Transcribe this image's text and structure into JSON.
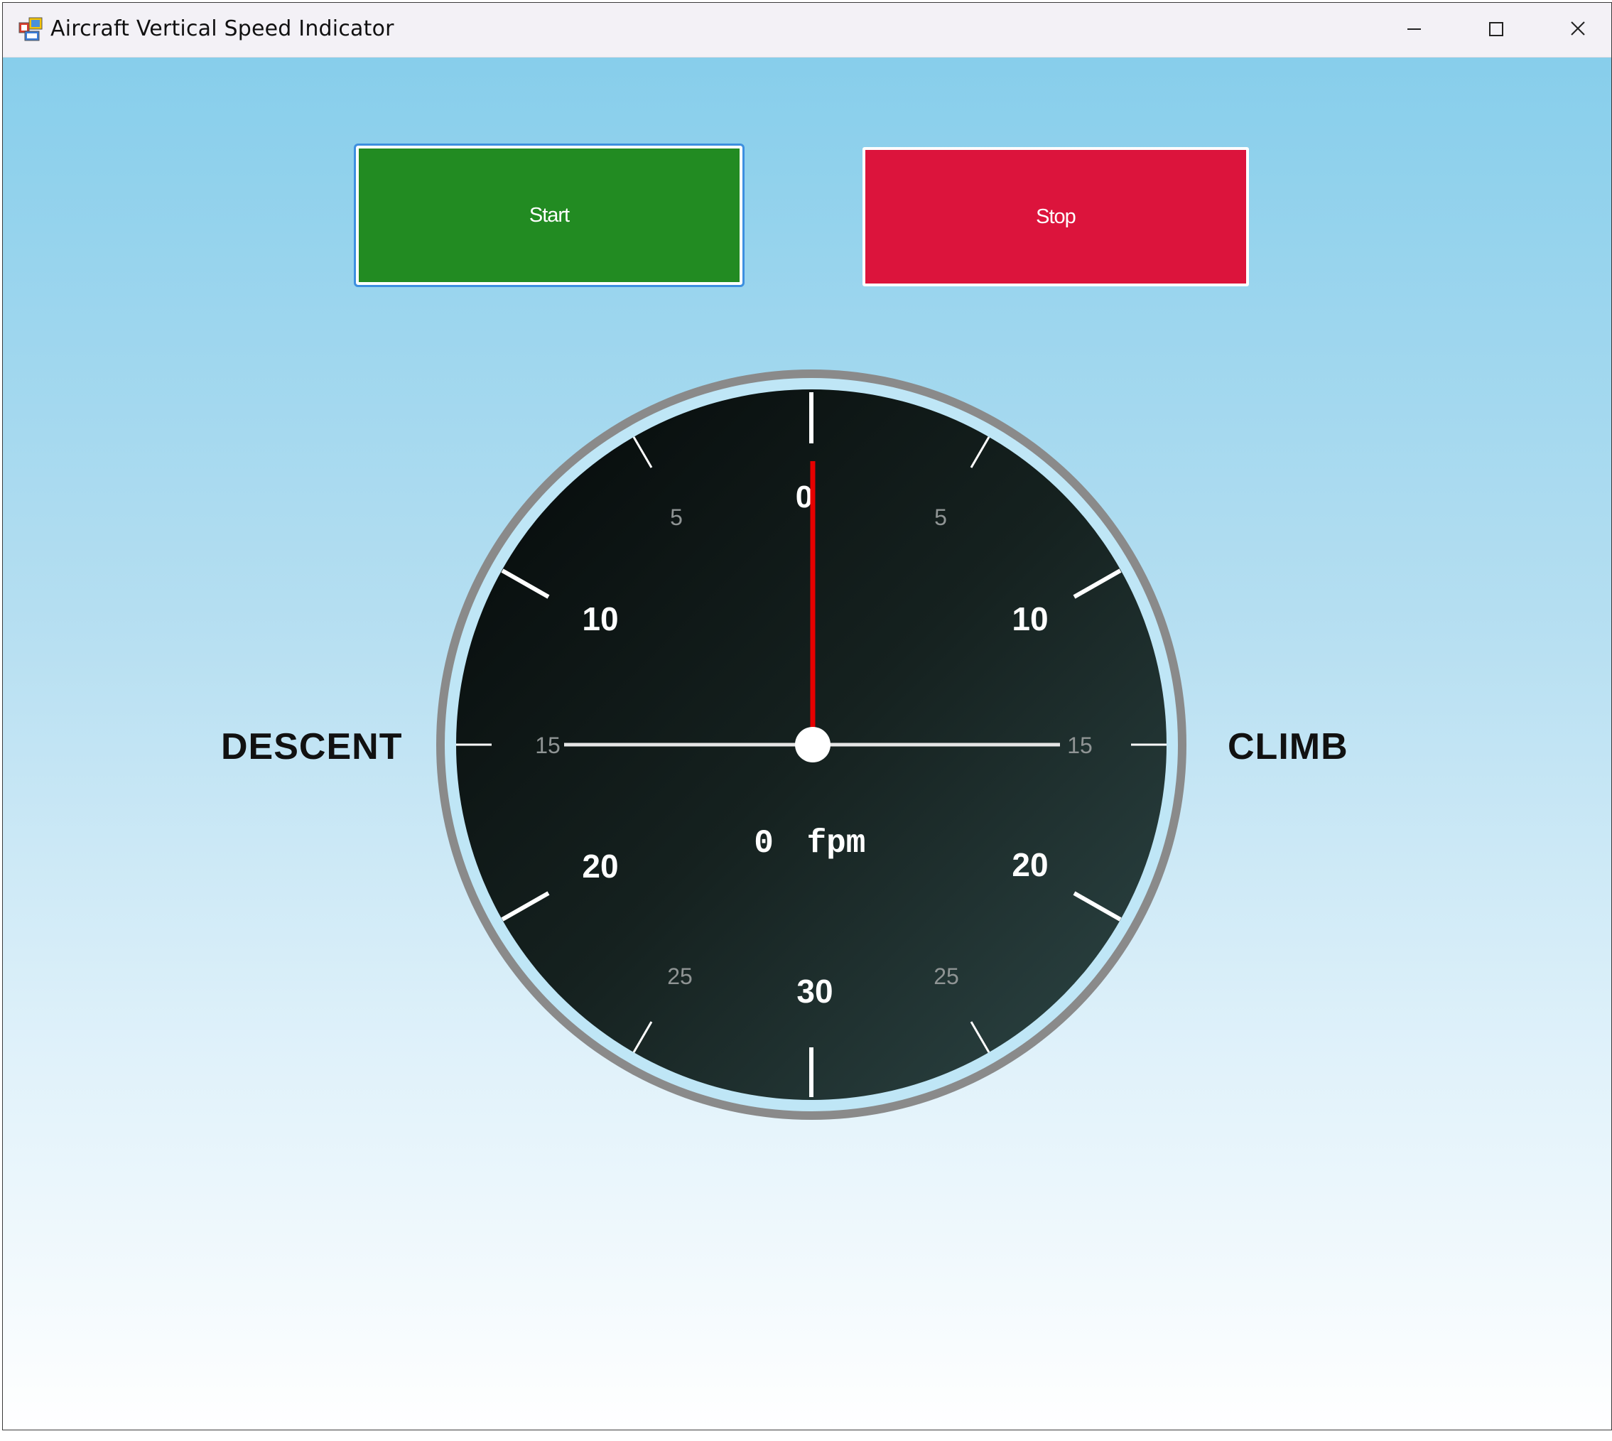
{
  "window": {
    "title": "Aircraft Vertical Speed Indicator"
  },
  "titlebar": {
    "app_icon": "app-windows-icon",
    "controls": [
      "minimize-icon",
      "maximize-icon",
      "close-icon"
    ]
  },
  "controls": {
    "start_label": "Start",
    "stop_label": "Stop"
  },
  "labels": {
    "descent": "DESCENT",
    "climb": "CLIMB"
  },
  "gauge": {
    "major_labels": {
      "top": "0",
      "left_upper": "10",
      "right_upper": "10",
      "left_lower": "20",
      "right_lower": "20",
      "bottom": "30"
    },
    "minor_labels": {
      "left_top": "5",
      "right_top": "5",
      "left_mid": "15",
      "right_mid": "15",
      "left_bottom": "25",
      "right_bottom": "25"
    },
    "readout_value": "0",
    "readout_unit": "fpm",
    "needle_value": 0,
    "colors": {
      "needle": "#e60000",
      "bezel": "#8a8a8a",
      "face_dark": "#080c0c",
      "face_light": "#2a4242",
      "start_button": "#228b22",
      "stop_button": "#dc143c",
      "background_top": "#87ceeb"
    }
  }
}
